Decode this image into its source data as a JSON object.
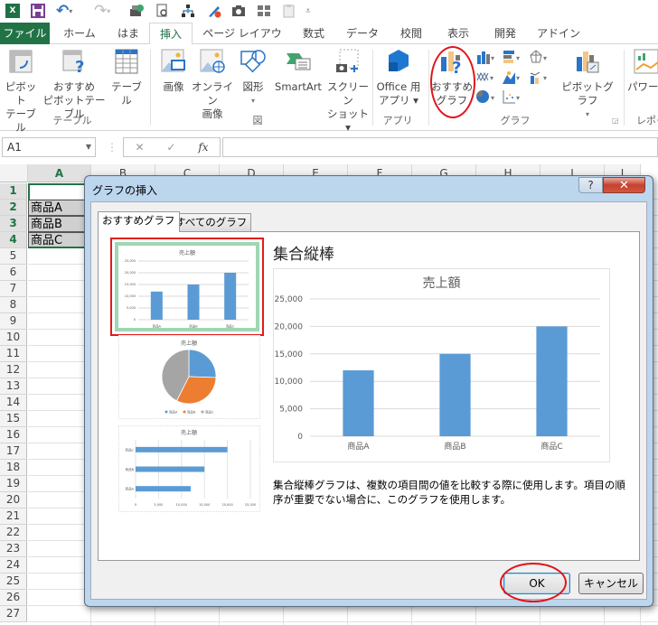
{
  "qat": {
    "icons": [
      "excel-logo",
      "save-icon",
      "undo-icon",
      "redo-icon",
      "print-preview-icon",
      "print-preview-doc-icon",
      "org-chart-icon",
      "pen-icon",
      "camera-icon",
      "grid-icon",
      "clipboard-icon",
      "customize-icon"
    ],
    "excel_label": "X"
  },
  "tabs": [
    {
      "label": "ファイル"
    },
    {
      "label": "ホーム"
    },
    {
      "label": "はま"
    },
    {
      "label": "挿入"
    },
    {
      "label": "ページ レイアウト"
    },
    {
      "label": "数式"
    },
    {
      "label": "データ"
    },
    {
      "label": "校閲"
    },
    {
      "label": "表示"
    },
    {
      "label": "開発"
    },
    {
      "label": "アドイン"
    }
  ],
  "ribbon": {
    "groups": {
      "table": "テーブル",
      "illustrations": "図",
      "apps": "アプリ",
      "charts": "グラフ",
      "reports": "レポー"
    },
    "buttons": {
      "pivot_table": [
        "ピボット",
        "テーブル"
      ],
      "recommended_pivot": [
        "おすすめ",
        "ピボットテーブル"
      ],
      "table": [
        "テーブル"
      ],
      "picture": [
        "画像"
      ],
      "online_picture": [
        "オンライン",
        "画像"
      ],
      "shapes": [
        "図形",
        "▾"
      ],
      "smartart": [
        "SmartArt"
      ],
      "screenshot": [
        "スクリーン",
        "ショット ▾"
      ],
      "office_apps": [
        "Office 用",
        "アプリ ▾"
      ],
      "recommended_charts": [
        "おすすめ",
        "グラフ"
      ],
      "pivot_chart": [
        "ピボットグラフ",
        "▾"
      ],
      "power_view": [
        "パワー"
      ]
    }
  },
  "formula_bar": {
    "name_box": "A1",
    "cancel": "✕",
    "enter": "✓",
    "fx": "fx",
    "value": ""
  },
  "grid": {
    "columns": [
      "A",
      "B",
      "C",
      "D",
      "E",
      "F",
      "G",
      "H",
      "I",
      "J"
    ],
    "rows": [
      "1",
      "2",
      "3",
      "4",
      "5",
      "6",
      "7",
      "8",
      "9",
      "10",
      "11",
      "12",
      "13",
      "14",
      "15",
      "16",
      "17",
      "18",
      "19",
      "20",
      "21",
      "22",
      "23",
      "24",
      "25",
      "26",
      "27"
    ],
    "cells": {
      "A1": "",
      "A2": "商品A",
      "A3": "商品B",
      "A4": "商品C"
    }
  },
  "dialog": {
    "title": "グラフの挿入",
    "help": "?",
    "close": "✕",
    "tabs": [
      "おすすめグラフ",
      "すべてのグラフ"
    ],
    "active_tab": 0,
    "selected_chart_type": "集合縦棒",
    "description": "集合縦棒グラフは、複数の項目間の値を比較する際に使用します。項目の順序が重要でない場合に、このグラフを使用します。",
    "ok": "OK",
    "cancel": "キャンセル",
    "thumbnails": [
      {
        "type": "column",
        "title": "売上額",
        "selected": true
      },
      {
        "type": "pie",
        "title": "売上額",
        "legend": [
          "商品A",
          "商品B",
          "商品C"
        ]
      },
      {
        "type": "bar",
        "title": "売上額"
      }
    ]
  },
  "chart_data": {
    "type": "bar",
    "title": "売上額",
    "categories": [
      "商品A",
      "商品B",
      "商品C"
    ],
    "values": [
      12000,
      15000,
      20000
    ],
    "yticks": [
      "0",
      "5,000",
      "10,000",
      "15,000",
      "20,000",
      "25,000"
    ],
    "ylim": [
      0,
      25000
    ],
    "xlabel": "",
    "ylabel": "",
    "grid": true,
    "color": "#5b9bd5",
    "pie_colors": [
      "#5b9bd5",
      "#ed7d31",
      "#a5a5a5"
    ]
  },
  "colors": {
    "excel_green": "#217346",
    "annotation_red": "#e0141b",
    "selection_border": "#e31b1b",
    "thumb_highlight": "#9fd7b4"
  }
}
